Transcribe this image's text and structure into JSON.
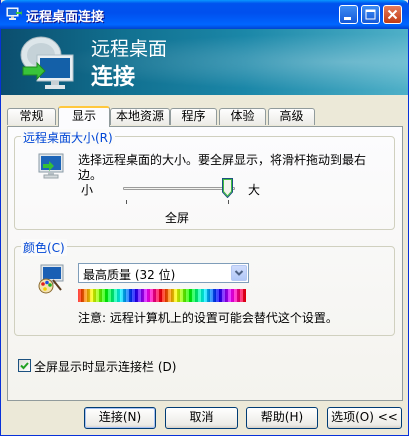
{
  "window": {
    "title": "远程桌面连接",
    "colors": {
      "titlebar": "#0054e3",
      "dialog_bg": "#ece9d8",
      "accent_blue": "#0046d5",
      "banner": "#117090"
    }
  },
  "banner": {
    "line1": "远程桌面",
    "line2": "连接"
  },
  "tabs": [
    {
      "label": "常规"
    },
    {
      "label": "显示",
      "active": true
    },
    {
      "label": "本地资源"
    },
    {
      "label": "程序"
    },
    {
      "label": "体验"
    },
    {
      "label": "高级"
    }
  ],
  "display_size": {
    "legend": "远程桌面大小(R)",
    "description": "选择远程桌面的大小。要全屏显示，将滑杆拖动到最右边。",
    "desc_line1": "选择远程桌面的大小。要全屏显示，将滑杆拖动到最右",
    "desc_line2": "边。",
    "min_label": "小",
    "max_label": "大",
    "current_value": "全屏",
    "slider_level": 1.0
  },
  "colors": {
    "legend": "颜色(C)",
    "selected": "最高质量 (32 位)",
    "note": "注意: 远程计算机上的设置可能会替代这个设置。"
  },
  "fullscreen_bar": {
    "label": "全屏显示时显示连接栏 (D)",
    "checked": true
  },
  "buttons": {
    "connect": "连接(N)",
    "cancel": "取消",
    "help": "帮助(H)",
    "options": "选项(O) <<"
  }
}
